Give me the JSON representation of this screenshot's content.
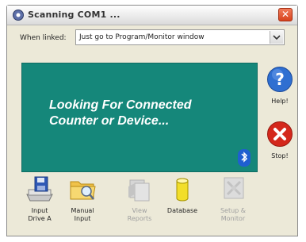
{
  "window": {
    "title": "Scanning COM1 ..."
  },
  "when_linked": {
    "label": "When linked:",
    "value": "Just go to Program/Monitor window"
  },
  "status_panel": {
    "line1": "Looking For Connected",
    "line2": "Counter or Device..."
  },
  "side_buttons": {
    "help_label": "Help!",
    "stop_label": "Stop!"
  },
  "bottom_buttons": {
    "input_drive_a": "Input\nDrive A",
    "manual_input": "Manual\nInput",
    "view_reports": "View\nReports",
    "database": "Database",
    "setup_monitor": "Setup &\nMonitor"
  },
  "colors": {
    "panel": "#15877a",
    "help": "#2f6fd1",
    "stop": "#d4281c"
  },
  "icons": {
    "title": "app-icon",
    "close": "close-icon",
    "help": "help-icon",
    "stop": "stop-icon",
    "bluetooth": "bluetooth-icon",
    "input_drive": "floppy-drive-icon",
    "manual_input": "folder-icon",
    "view_reports": "reports-icon",
    "database": "database-icon",
    "setup": "setup-icon"
  }
}
